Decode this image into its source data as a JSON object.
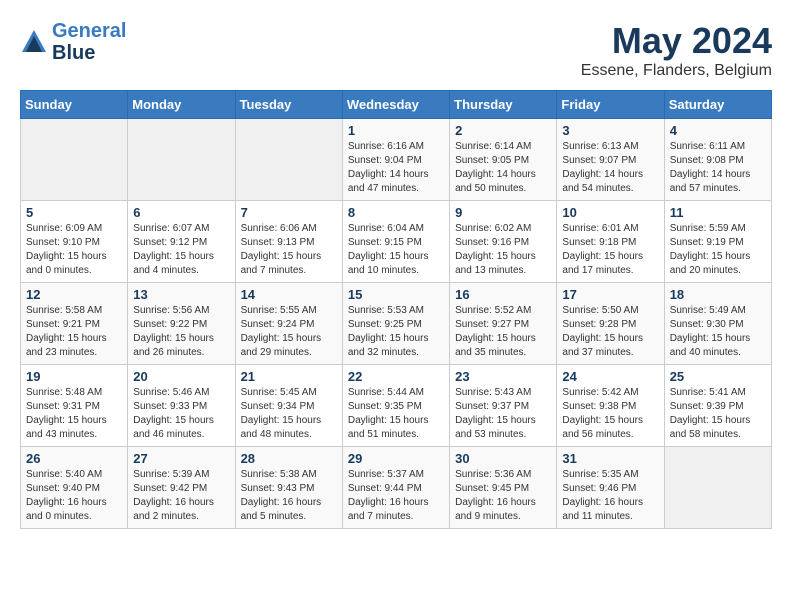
{
  "header": {
    "logo_line1": "General",
    "logo_line2": "Blue",
    "month_year": "May 2024",
    "location": "Essene, Flanders, Belgium"
  },
  "days_of_week": [
    "Sunday",
    "Monday",
    "Tuesday",
    "Wednesday",
    "Thursday",
    "Friday",
    "Saturday"
  ],
  "weeks": [
    [
      {
        "day": "",
        "sunrise": "",
        "sunset": "",
        "daylight": ""
      },
      {
        "day": "",
        "sunrise": "",
        "sunset": "",
        "daylight": ""
      },
      {
        "day": "",
        "sunrise": "",
        "sunset": "",
        "daylight": ""
      },
      {
        "day": "1",
        "sunrise": "Sunrise: 6:16 AM",
        "sunset": "Sunset: 9:04 PM",
        "daylight": "Daylight: 14 hours and 47 minutes."
      },
      {
        "day": "2",
        "sunrise": "Sunrise: 6:14 AM",
        "sunset": "Sunset: 9:05 PM",
        "daylight": "Daylight: 14 hours and 50 minutes."
      },
      {
        "day": "3",
        "sunrise": "Sunrise: 6:13 AM",
        "sunset": "Sunset: 9:07 PM",
        "daylight": "Daylight: 14 hours and 54 minutes."
      },
      {
        "day": "4",
        "sunrise": "Sunrise: 6:11 AM",
        "sunset": "Sunset: 9:08 PM",
        "daylight": "Daylight: 14 hours and 57 minutes."
      }
    ],
    [
      {
        "day": "5",
        "sunrise": "Sunrise: 6:09 AM",
        "sunset": "Sunset: 9:10 PM",
        "daylight": "Daylight: 15 hours and 0 minutes."
      },
      {
        "day": "6",
        "sunrise": "Sunrise: 6:07 AM",
        "sunset": "Sunset: 9:12 PM",
        "daylight": "Daylight: 15 hours and 4 minutes."
      },
      {
        "day": "7",
        "sunrise": "Sunrise: 6:06 AM",
        "sunset": "Sunset: 9:13 PM",
        "daylight": "Daylight: 15 hours and 7 minutes."
      },
      {
        "day": "8",
        "sunrise": "Sunrise: 6:04 AM",
        "sunset": "Sunset: 9:15 PM",
        "daylight": "Daylight: 15 hours and 10 minutes."
      },
      {
        "day": "9",
        "sunrise": "Sunrise: 6:02 AM",
        "sunset": "Sunset: 9:16 PM",
        "daylight": "Daylight: 15 hours and 13 minutes."
      },
      {
        "day": "10",
        "sunrise": "Sunrise: 6:01 AM",
        "sunset": "Sunset: 9:18 PM",
        "daylight": "Daylight: 15 hours and 17 minutes."
      },
      {
        "day": "11",
        "sunrise": "Sunrise: 5:59 AM",
        "sunset": "Sunset: 9:19 PM",
        "daylight": "Daylight: 15 hours and 20 minutes."
      }
    ],
    [
      {
        "day": "12",
        "sunrise": "Sunrise: 5:58 AM",
        "sunset": "Sunset: 9:21 PM",
        "daylight": "Daylight: 15 hours and 23 minutes."
      },
      {
        "day": "13",
        "sunrise": "Sunrise: 5:56 AM",
        "sunset": "Sunset: 9:22 PM",
        "daylight": "Daylight: 15 hours and 26 minutes."
      },
      {
        "day": "14",
        "sunrise": "Sunrise: 5:55 AM",
        "sunset": "Sunset: 9:24 PM",
        "daylight": "Daylight: 15 hours and 29 minutes."
      },
      {
        "day": "15",
        "sunrise": "Sunrise: 5:53 AM",
        "sunset": "Sunset: 9:25 PM",
        "daylight": "Daylight: 15 hours and 32 minutes."
      },
      {
        "day": "16",
        "sunrise": "Sunrise: 5:52 AM",
        "sunset": "Sunset: 9:27 PM",
        "daylight": "Daylight: 15 hours and 35 minutes."
      },
      {
        "day": "17",
        "sunrise": "Sunrise: 5:50 AM",
        "sunset": "Sunset: 9:28 PM",
        "daylight": "Daylight: 15 hours and 37 minutes."
      },
      {
        "day": "18",
        "sunrise": "Sunrise: 5:49 AM",
        "sunset": "Sunset: 9:30 PM",
        "daylight": "Daylight: 15 hours and 40 minutes."
      }
    ],
    [
      {
        "day": "19",
        "sunrise": "Sunrise: 5:48 AM",
        "sunset": "Sunset: 9:31 PM",
        "daylight": "Daylight: 15 hours and 43 minutes."
      },
      {
        "day": "20",
        "sunrise": "Sunrise: 5:46 AM",
        "sunset": "Sunset: 9:33 PM",
        "daylight": "Daylight: 15 hours and 46 minutes."
      },
      {
        "day": "21",
        "sunrise": "Sunrise: 5:45 AM",
        "sunset": "Sunset: 9:34 PM",
        "daylight": "Daylight: 15 hours and 48 minutes."
      },
      {
        "day": "22",
        "sunrise": "Sunrise: 5:44 AM",
        "sunset": "Sunset: 9:35 PM",
        "daylight": "Daylight: 15 hours and 51 minutes."
      },
      {
        "day": "23",
        "sunrise": "Sunrise: 5:43 AM",
        "sunset": "Sunset: 9:37 PM",
        "daylight": "Daylight: 15 hours and 53 minutes."
      },
      {
        "day": "24",
        "sunrise": "Sunrise: 5:42 AM",
        "sunset": "Sunset: 9:38 PM",
        "daylight": "Daylight: 15 hours and 56 minutes."
      },
      {
        "day": "25",
        "sunrise": "Sunrise: 5:41 AM",
        "sunset": "Sunset: 9:39 PM",
        "daylight": "Daylight: 15 hours and 58 minutes."
      }
    ],
    [
      {
        "day": "26",
        "sunrise": "Sunrise: 5:40 AM",
        "sunset": "Sunset: 9:40 PM",
        "daylight": "Daylight: 16 hours and 0 minutes."
      },
      {
        "day": "27",
        "sunrise": "Sunrise: 5:39 AM",
        "sunset": "Sunset: 9:42 PM",
        "daylight": "Daylight: 16 hours and 2 minutes."
      },
      {
        "day": "28",
        "sunrise": "Sunrise: 5:38 AM",
        "sunset": "Sunset: 9:43 PM",
        "daylight": "Daylight: 16 hours and 5 minutes."
      },
      {
        "day": "29",
        "sunrise": "Sunrise: 5:37 AM",
        "sunset": "Sunset: 9:44 PM",
        "daylight": "Daylight: 16 hours and 7 minutes."
      },
      {
        "day": "30",
        "sunrise": "Sunrise: 5:36 AM",
        "sunset": "Sunset: 9:45 PM",
        "daylight": "Daylight: 16 hours and 9 minutes."
      },
      {
        "day": "31",
        "sunrise": "Sunrise: 5:35 AM",
        "sunset": "Sunset: 9:46 PM",
        "daylight": "Daylight: 16 hours and 11 minutes."
      },
      {
        "day": "",
        "sunrise": "",
        "sunset": "",
        "daylight": ""
      }
    ]
  ]
}
